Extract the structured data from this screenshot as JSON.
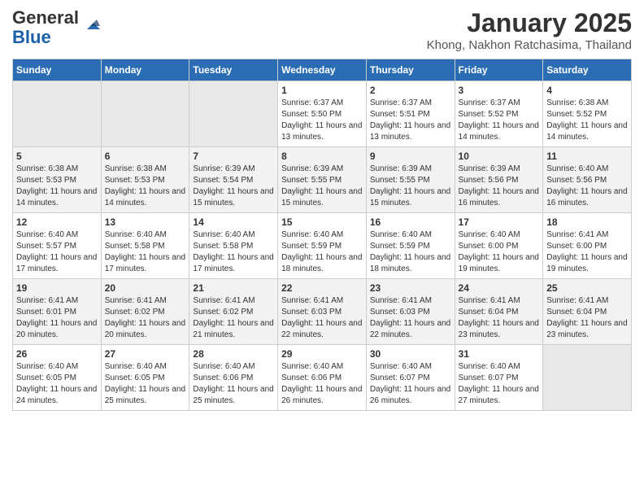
{
  "header": {
    "logo_general": "General",
    "logo_blue": "Blue",
    "month_title": "January 2025",
    "location": "Khong, Nakhon Ratchasima, Thailand"
  },
  "weekdays": [
    "Sunday",
    "Monday",
    "Tuesday",
    "Wednesday",
    "Thursday",
    "Friday",
    "Saturday"
  ],
  "weeks": [
    [
      {
        "day": "",
        "empty": true
      },
      {
        "day": "",
        "empty": true
      },
      {
        "day": "",
        "empty": true
      },
      {
        "day": "1",
        "sunrise": "6:37 AM",
        "sunset": "5:50 PM",
        "daylight": "11 hours and 13 minutes."
      },
      {
        "day": "2",
        "sunrise": "6:37 AM",
        "sunset": "5:51 PM",
        "daylight": "11 hours and 13 minutes."
      },
      {
        "day": "3",
        "sunrise": "6:37 AM",
        "sunset": "5:52 PM",
        "daylight": "11 hours and 14 minutes."
      },
      {
        "day": "4",
        "sunrise": "6:38 AM",
        "sunset": "5:52 PM",
        "daylight": "11 hours and 14 minutes."
      }
    ],
    [
      {
        "day": "5",
        "sunrise": "6:38 AM",
        "sunset": "5:53 PM",
        "daylight": "11 hours and 14 minutes."
      },
      {
        "day": "6",
        "sunrise": "6:38 AM",
        "sunset": "5:53 PM",
        "daylight": "11 hours and 14 minutes."
      },
      {
        "day": "7",
        "sunrise": "6:39 AM",
        "sunset": "5:54 PM",
        "daylight": "11 hours and 15 minutes."
      },
      {
        "day": "8",
        "sunrise": "6:39 AM",
        "sunset": "5:55 PM",
        "daylight": "11 hours and 15 minutes."
      },
      {
        "day": "9",
        "sunrise": "6:39 AM",
        "sunset": "5:55 PM",
        "daylight": "11 hours and 15 minutes."
      },
      {
        "day": "10",
        "sunrise": "6:39 AM",
        "sunset": "5:56 PM",
        "daylight": "11 hours and 16 minutes."
      },
      {
        "day": "11",
        "sunrise": "6:40 AM",
        "sunset": "5:56 PM",
        "daylight": "11 hours and 16 minutes."
      }
    ],
    [
      {
        "day": "12",
        "sunrise": "6:40 AM",
        "sunset": "5:57 PM",
        "daylight": "11 hours and 17 minutes."
      },
      {
        "day": "13",
        "sunrise": "6:40 AM",
        "sunset": "5:58 PM",
        "daylight": "11 hours and 17 minutes."
      },
      {
        "day": "14",
        "sunrise": "6:40 AM",
        "sunset": "5:58 PM",
        "daylight": "11 hours and 17 minutes."
      },
      {
        "day": "15",
        "sunrise": "6:40 AM",
        "sunset": "5:59 PM",
        "daylight": "11 hours and 18 minutes."
      },
      {
        "day": "16",
        "sunrise": "6:40 AM",
        "sunset": "5:59 PM",
        "daylight": "11 hours and 18 minutes."
      },
      {
        "day": "17",
        "sunrise": "6:40 AM",
        "sunset": "6:00 PM",
        "daylight": "11 hours and 19 minutes."
      },
      {
        "day": "18",
        "sunrise": "6:41 AM",
        "sunset": "6:00 PM",
        "daylight": "11 hours and 19 minutes."
      }
    ],
    [
      {
        "day": "19",
        "sunrise": "6:41 AM",
        "sunset": "6:01 PM",
        "daylight": "11 hours and 20 minutes."
      },
      {
        "day": "20",
        "sunrise": "6:41 AM",
        "sunset": "6:02 PM",
        "daylight": "11 hours and 20 minutes."
      },
      {
        "day": "21",
        "sunrise": "6:41 AM",
        "sunset": "6:02 PM",
        "daylight": "11 hours and 21 minutes."
      },
      {
        "day": "22",
        "sunrise": "6:41 AM",
        "sunset": "6:03 PM",
        "daylight": "11 hours and 22 minutes."
      },
      {
        "day": "23",
        "sunrise": "6:41 AM",
        "sunset": "6:03 PM",
        "daylight": "11 hours and 22 minutes."
      },
      {
        "day": "24",
        "sunrise": "6:41 AM",
        "sunset": "6:04 PM",
        "daylight": "11 hours and 23 minutes."
      },
      {
        "day": "25",
        "sunrise": "6:41 AM",
        "sunset": "6:04 PM",
        "daylight": "11 hours and 23 minutes."
      }
    ],
    [
      {
        "day": "26",
        "sunrise": "6:40 AM",
        "sunset": "6:05 PM",
        "daylight": "11 hours and 24 minutes."
      },
      {
        "day": "27",
        "sunrise": "6:40 AM",
        "sunset": "6:05 PM",
        "daylight": "11 hours and 25 minutes."
      },
      {
        "day": "28",
        "sunrise": "6:40 AM",
        "sunset": "6:06 PM",
        "daylight": "11 hours and 25 minutes."
      },
      {
        "day": "29",
        "sunrise": "6:40 AM",
        "sunset": "6:06 PM",
        "daylight": "11 hours and 26 minutes."
      },
      {
        "day": "30",
        "sunrise": "6:40 AM",
        "sunset": "6:07 PM",
        "daylight": "11 hours and 26 minutes."
      },
      {
        "day": "31",
        "sunrise": "6:40 AM",
        "sunset": "6:07 PM",
        "daylight": "11 hours and 27 minutes."
      },
      {
        "day": "",
        "empty": true
      }
    ]
  ]
}
